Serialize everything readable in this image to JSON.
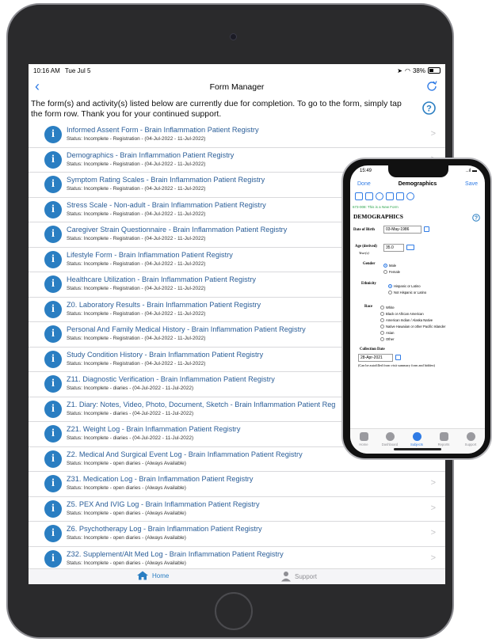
{
  "ipad": {
    "status": {
      "time": "10:16 AM",
      "date": "Tue Jul 5",
      "battery": "38%"
    },
    "nav": {
      "back_icon": "chevron-left-icon",
      "title": "Form Manager",
      "refresh_icon": "refresh-icon"
    },
    "intro": "The form(s) and activity(s) listed below are currently due for completion. To go to the form, simply tap the form row. Thank you for your continued support.",
    "help_icon": "question-circle-icon",
    "forms": [
      {
        "title": "Informed Assent Form - Brain Inflammation Patient Registry",
        "status": "Status: Incomplete - Registration - (04-Jul-2022 - 11-Jul-2022)"
      },
      {
        "title": "Demographics - Brain Inflammation Patient Registry",
        "status": "Status: Incomplete - Registration - (04-Jul-2022 - 11-Jul-2022)"
      },
      {
        "title": "Symptom Rating Scales - Brain Inflammation Patient Registry",
        "status": "Status: Incomplete - Registration - (04-Jul-2022 - 11-Jul-2022)"
      },
      {
        "title": "Stress Scale - Non-adult - Brain Inflammation Patient Registry",
        "status": "Status: Incomplete - Registration - (04-Jul-2022 - 11-Jul-2022)"
      },
      {
        "title": "Caregiver Strain Questionnaire - Brain Inflammation Patient Registry",
        "status": "Status: Incomplete - Registration - (04-Jul-2022 - 11-Jul-2022)"
      },
      {
        "title": "Lifestyle Form - Brain Inflammation Patient Registry",
        "status": "Status: Incomplete - Registration - (04-Jul-2022 - 11-Jul-2022)"
      },
      {
        "title": "Healthcare Utilization - Brain Inflammation Patient Registry",
        "status": "Status: Incomplete - Registration - (04-Jul-2022 - 11-Jul-2022)"
      },
      {
        "title": "Z0. Laboratory Results - Brain Inflammation Patient Registry",
        "status": "Status: Incomplete - Registration - (04-Jul-2022 - 11-Jul-2022)"
      },
      {
        "title": "Personal And Family Medical History - Brain Inflammation Patient Registry",
        "status": "Status: Incomplete - Registration - (04-Jul-2022 - 11-Jul-2022)"
      },
      {
        "title": "Study Condition History - Brain Inflammation Patient Registry",
        "status": "Status: Incomplete - Registration - (04-Jul-2022 - 11-Jul-2022)"
      },
      {
        "title": "Z11. Diagnostic Verification - Brain Inflammation Patient Registry",
        "status": "Status: Incomplete - diaries - (04-Jul-2022 - 11-Jul-2022)"
      },
      {
        "title": "Z1. Diary: Notes, Video, Photo, Document, Sketch - Brain Inflammation Patient Reg",
        "status": "Status: Incomplete - diaries - (04-Jul-2022 - 11-Jul-2022)"
      },
      {
        "title": "Z21. Weight Log - Brain Inflammation Patient Registry",
        "status": "Status: Incomplete - diaries - (04-Jul-2022 - 11-Jul-2022)"
      },
      {
        "title": "Z2. Medical And Surgical Event Log - Brain Inflammation Patient Registry",
        "status": "Status: Incomplete - open diaries - (Always Available)"
      },
      {
        "title": "Z31. Medication Log - Brain Inflammation Patient Registry",
        "status": "Status: Incomplete - open diaries - (Always Available)"
      },
      {
        "title": "Z5. PEX And IVIG Log - Brain Inflammation Patient Registry",
        "status": "Status: Incomplete - open diaries - (Always Available)"
      },
      {
        "title": "Z6. Psychotherapy Log - Brain Inflammation Patient Registry",
        "status": "Status: Incomplete - open diaries - (Always Available)"
      },
      {
        "title": "Z32. Supplement/Alt Med Log - Brain Inflammation Patient Registry",
        "status": "Status: Incomplete - open diaries - (Always Available)"
      }
    ],
    "form_icon_letter": "i",
    "row_chevron": ">",
    "tabbar": {
      "home": "Home",
      "support": "Support"
    }
  },
  "iphone": {
    "status": {
      "time": "15:49",
      "signal": "..ıl",
      "battery": "▬"
    },
    "nav": {
      "done": "Done",
      "title": "Demographics",
      "save": "Save"
    },
    "new_form": "673-008: This is a New Form",
    "section": "DEMOGRAPHICS",
    "dob_label": "Date of Birth",
    "dob_value": "03-May-1986",
    "age_label": "Age (derived)",
    "age_unit": "Year(s)",
    "age_value": "35.0",
    "gender_label": "Gender",
    "gender_options": [
      "Male",
      "Female"
    ],
    "ethnicity_label": "Ethnicity",
    "ethnicity_options": [
      "Hispanic or Latino",
      "Not Hispanic or Latino"
    ],
    "race_label": "Race",
    "race_options": [
      "White",
      "Black or African American",
      "American Indian / Alaska Native",
      "Native Hawaiian or other Pacific Islander",
      "Asian",
      "Other"
    ],
    "collection_label": "Collection Date",
    "collection_value": "28-Apr-2021",
    "collection_note": "(Can be autofilled from visit summary form and hidden)",
    "tabs": [
      "Home",
      "Dashboard",
      "Subjects",
      "Reports",
      "Support"
    ]
  },
  "colors": {
    "accent": "#2a7ec2",
    "link": "#2b5e98",
    "ios_blue": "#2f7be5",
    "green": "#2aa34b"
  }
}
